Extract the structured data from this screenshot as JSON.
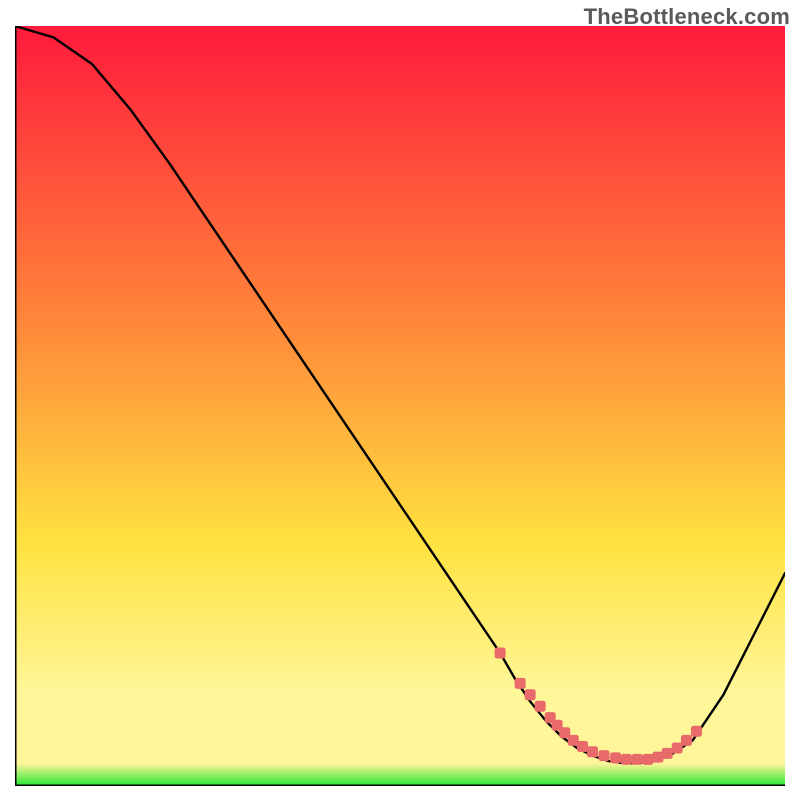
{
  "watermark": "TheBottleneck.com",
  "colors": {
    "grad_top": "#ff1a3c",
    "grad_mid_orange": "#ff8a3a",
    "grad_mid_yellow": "#ffe240",
    "grad_pale_yellow": "#fff69a",
    "grad_green": "#27e833",
    "curve": "#000000",
    "marker": "#e96a6a",
    "axis": "#000000"
  },
  "chart_data": {
    "type": "line",
    "title": "",
    "xlabel": "",
    "ylabel": "",
    "x": [
      0,
      5,
      10,
      15,
      20,
      25,
      30,
      35,
      40,
      45,
      50,
      55,
      60,
      63,
      65,
      67,
      69,
      71,
      73,
      75,
      77,
      79,
      81,
      83,
      85,
      88,
      92,
      96,
      100
    ],
    "values": [
      100,
      98.5,
      95,
      89,
      82,
      74.5,
      67,
      59.5,
      52,
      44.5,
      37,
      29.5,
      22,
      17.5,
      14,
      11,
      8.5,
      6.5,
      5,
      4,
      3.3,
      3,
      3,
      3.3,
      4,
      6,
      12,
      20,
      28
    ],
    "xlim": [
      0,
      100
    ],
    "ylim": [
      0,
      100
    ],
    "markers": {
      "x": [
        63.0,
        65.6,
        66.9,
        68.2,
        69.5,
        70.4,
        71.4,
        72.5,
        73.7,
        75.0,
        76.5,
        78.0,
        79.4,
        80.8,
        82.2,
        83.5,
        84.7,
        86.0,
        87.2,
        88.5
      ],
      "y": [
        17.5,
        13.5,
        12.0,
        10.5,
        9.0,
        8.0,
        7.0,
        6.0,
        5.2,
        4.5,
        4.0,
        3.7,
        3.5,
        3.5,
        3.5,
        3.8,
        4.3,
        5.0,
        6.0,
        7.2
      ]
    }
  }
}
